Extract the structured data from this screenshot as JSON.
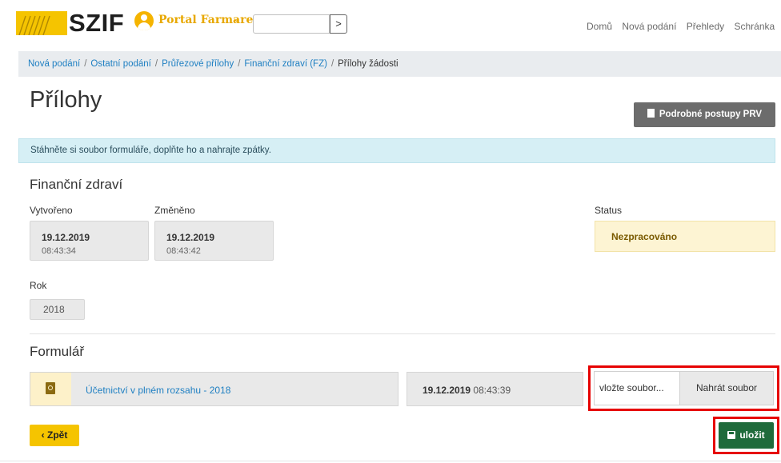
{
  "header": {
    "logo_text": "SZIF",
    "portal_label": "Portal Farmare",
    "portal_chevron": "⌄",
    "go_button": ">",
    "nav": [
      "Domů",
      "Nová podání",
      "Přehledy",
      "Schránka"
    ]
  },
  "breadcrumb": {
    "items": [
      "Nová podání",
      "Ostatní podání",
      "Průřezové přílohy",
      "Finanční zdraví (FZ)"
    ],
    "current": "Přílohy žádosti",
    "separator": "/"
  },
  "page": {
    "title": "Přílohy",
    "guide_button": "Podrobné postupy PRV",
    "alert": "Stáhněte si soubor formuláře, doplňte ho a nahrajte zpátky."
  },
  "detail": {
    "section_title": "Finanční zdraví",
    "created_label": "Vytvořeno",
    "created_date": "19.12.2019",
    "created_time": "08:43:34",
    "changed_label": "Změněno",
    "changed_date": "19.12.2019",
    "changed_time": "08:43:42",
    "status_label": "Status",
    "status_value": "Nezpracováno",
    "year_label": "Rok",
    "year_value": "2018"
  },
  "form": {
    "section_title": "Formulář",
    "document_name": "Účetnictví v plném rozsahu - 2018",
    "document_date": "19.12.2019",
    "document_time": "08:43:39",
    "file_placeholder": "vložte soubor...",
    "upload_button": "Nahrát soubor"
  },
  "actions": {
    "back_label": "Zpět",
    "back_arrow": "‹",
    "save_label": "uložit"
  },
  "colors": {
    "brand_yellow": "#f5c400",
    "link_blue": "#1e7fc2",
    "save_green": "#1f6b3b",
    "highlight_red": "#e60000",
    "alert_bg": "#d6eff5",
    "status_bg": "#fdf4d3"
  },
  "icons": {
    "user": "user-icon",
    "pdf": "file-pdf-icon",
    "save": "floppy-disk-icon",
    "guide": "document-icon"
  }
}
